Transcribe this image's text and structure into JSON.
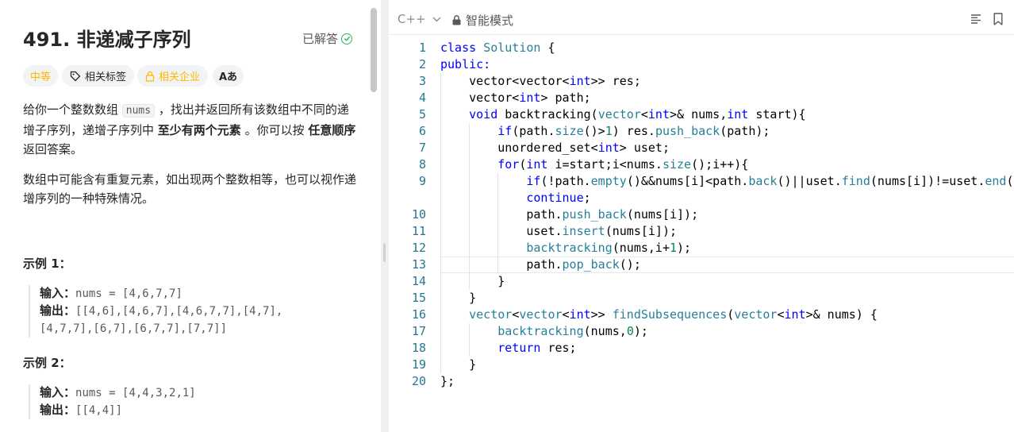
{
  "problem": {
    "title": "491. 非递减子序列",
    "solved_label": "已解答",
    "tags": {
      "difficulty": "中等",
      "topics": "相关标签",
      "companies": "相关企业",
      "translate": "Aあ"
    },
    "description": {
      "p1_a": "给你一个整数数组 ",
      "p1_code": "nums",
      "p1_b": " ，找出并返回所有该数组中不同的递增子序列，递增子序列中 ",
      "p1_bold1": "至少有两个元素",
      "p1_c": " 。你可以按 ",
      "p1_bold2": "任意顺序",
      "p1_d": " 返回答案。",
      "p2": "数组中可能含有重复元素，如出现两个整数相等，也可以视作递增序列的一种特殊情况。"
    },
    "examples": [
      {
        "heading": "示例 1：",
        "input_label": "输入：",
        "input_value": "nums = [4,6,7,7]",
        "output_label": "输出：",
        "output_value_line1": "[[4,6],[4,6,7],[4,6,7,7],[4,7],",
        "output_value_line2": "[4,7,7],[6,7],[6,7,7],[7,7]]"
      },
      {
        "heading": "示例 2：",
        "input_label": "输入：",
        "input_value": "nums = [4,4,3,2,1]",
        "output_label": "输出：",
        "output_value_line1": "[[4,4]]"
      }
    ]
  },
  "editor": {
    "language": "C++",
    "mode_label": "智能模式",
    "line_numbers": [
      "1",
      "2",
      "3",
      "4",
      "5",
      "6",
      "7",
      "8",
      "9",
      "",
      "10",
      "11",
      "12",
      "13",
      "14",
      "15",
      "16",
      "17",
      "18",
      "19",
      "20"
    ]
  },
  "colors": {
    "keyword": "#0000ff",
    "type": "#267f99",
    "number": "#098658",
    "line_number": "#237893",
    "difficulty": "#ffb800",
    "solved_check": "#2db55d"
  }
}
